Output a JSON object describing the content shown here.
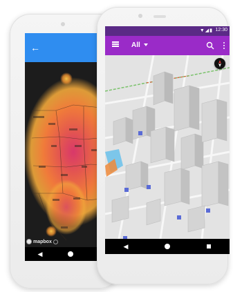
{
  "back_phone": {
    "map_attribution": "mapbox",
    "heat_colors": {
      "hot": "#d8386a",
      "warm": "#f07b3a",
      "mild": "#f2a93b",
      "appbar": "#2f8df0"
    },
    "icons": {
      "back": "arrow-left-icon",
      "info": "info-icon"
    }
  },
  "front_phone": {
    "status": {
      "time": "12:30"
    },
    "toolbar": {
      "filter_label": "All",
      "appbar_color": "#9a2bc8",
      "statusbar_color": "#5a2a86"
    },
    "icons": {
      "menu": "hamburger-menu-icon",
      "search": "search-icon",
      "more": "more-vert-icon",
      "compass": "compass-icon"
    }
  }
}
